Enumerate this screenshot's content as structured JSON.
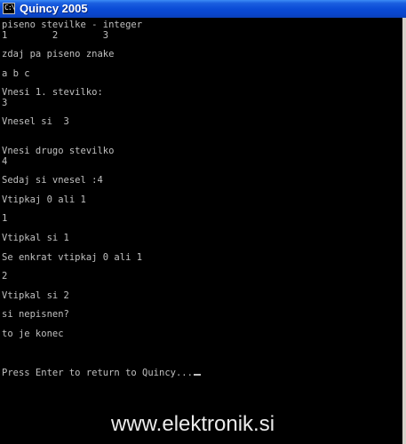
{
  "window": {
    "title": "Quincy 2005",
    "icon_label": "C:\\"
  },
  "console": {
    "lines": [
      "piseno stevilke - integer",
      "1        2        3",
      "zdaj pa piseno znake",
      "a b c",
      "Vnesi 1. stevilko:",
      "3",
      "Vnesel si  3",
      "Vnesi drugo stevilko",
      "4",
      "Sedaj si vnesel :4",
      "Vtipkaj 0 ali 1",
      "1",
      "Vtipkal si 1",
      "Se enkrat vtipkaj 0 ali 1",
      "2",
      "Vtipkal si 2",
      "si nepisnen?",
      "to je konec",
      "Press Enter to return to Quincy..."
    ]
  },
  "watermark": {
    "text": "www.elektronik.si"
  }
}
